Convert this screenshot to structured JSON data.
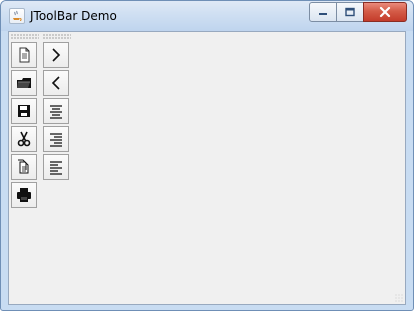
{
  "window": {
    "title": "JToolBar Demo",
    "app_icon": "java-coffee-cup-icon",
    "caption_buttons": [
      "minimize-icon",
      "maximize-icon",
      "close-icon"
    ]
  },
  "toolbars": {
    "left": [
      "new-document-icon",
      "open-folder-icon",
      "save-icon",
      "cut-icon",
      "copy-icon",
      "print-icon"
    ],
    "right": [
      "chevron-right-icon",
      "chevron-left-icon",
      "align-center-icon",
      "align-right-icon",
      "align-left-icon"
    ]
  },
  "colors": {
    "title_gradient_top": "#dfe9f6",
    "title_gradient_bottom": "#bfd4ee",
    "client_background": "#f0f0f0",
    "close_button_red": "#c43c2b"
  }
}
